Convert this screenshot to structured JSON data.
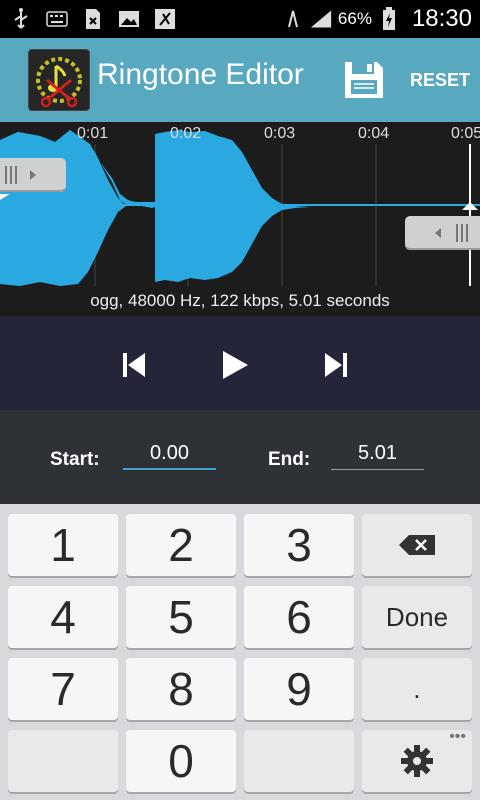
{
  "status_bar": {
    "icons": [
      "usb-icon",
      "keyboard-icon",
      "sim-icon",
      "gallery-icon",
      "ringtone-icon",
      "wifi-icon",
      "signal-icon",
      "battery-icon"
    ],
    "battery": "66%",
    "time": "18:30"
  },
  "action_bar": {
    "title": "Ringtone Editor",
    "save_icon": "save-icon",
    "reset_label": "RESET",
    "color": "#58a8c0"
  },
  "waveform": {
    "ticks": [
      "0:01",
      "0:02",
      "0:03",
      "0:04",
      "0:05"
    ],
    "info": "ogg, 48000 Hz, 122 kbps, 5.01 seconds",
    "color": "#2aa9e0"
  },
  "controls": {
    "prev_icon": "skip-previous-icon",
    "play_icon": "play-icon",
    "next_icon": "skip-next-icon"
  },
  "range": {
    "start_label": "Start:",
    "start_value": "0.00",
    "end_label": "End:",
    "end_value": "5.01"
  },
  "keyboard": {
    "keys": [
      "1",
      "2",
      "3",
      "4",
      "5",
      "6",
      "7",
      "8",
      "9",
      "0"
    ],
    "done_label": "Done",
    "dot_label": ".",
    "backspace_icon": "backspace-icon",
    "settings_icon": "gear-icon"
  }
}
